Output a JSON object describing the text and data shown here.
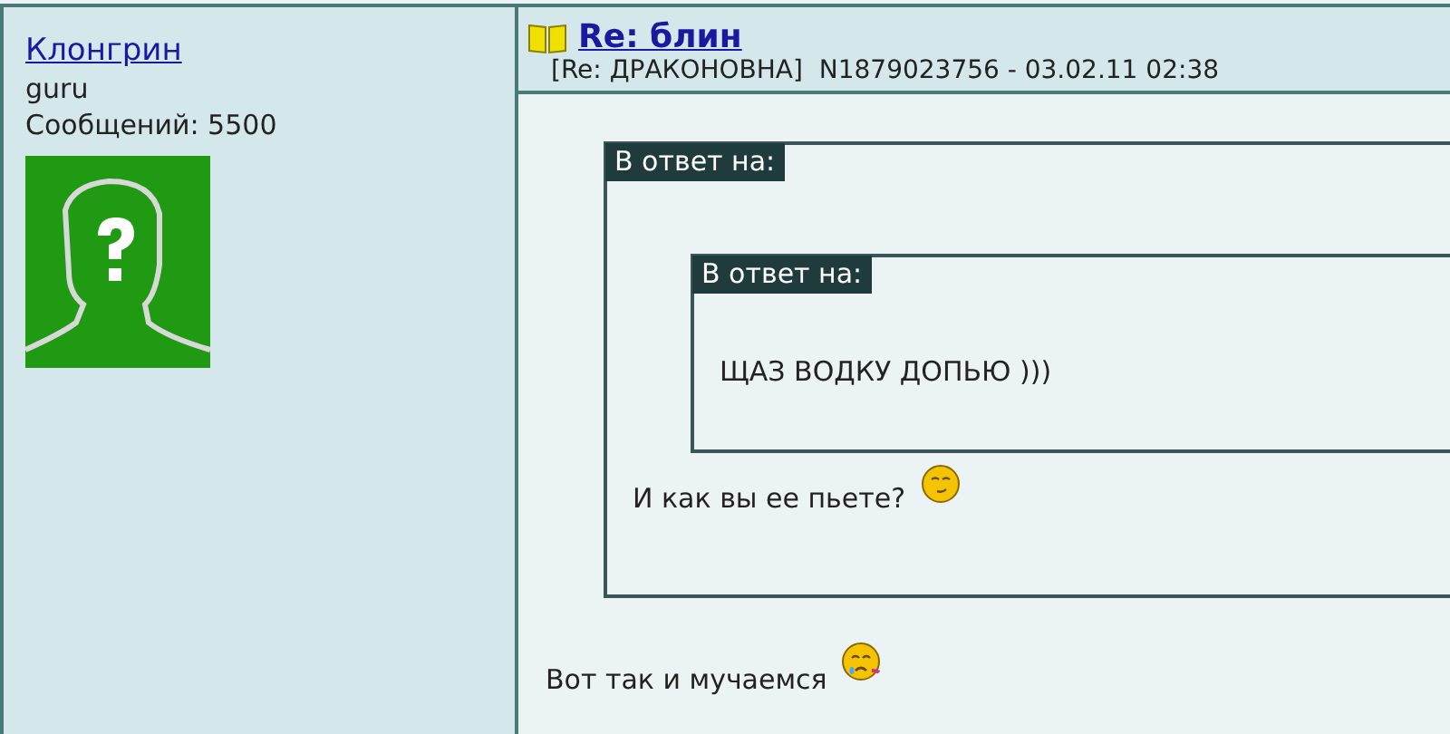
{
  "author": {
    "name": "Клонгрин",
    "rank": "guru",
    "posts": "Сообщений: 5500"
  },
  "post": {
    "title": "Re: блин",
    "meta": "[Re: ДРАКОНОВНА]  N1879023756 - 03.02.11 02:38",
    "quote": {
      "label": "В ответ на:",
      "text": "И как вы ее пьете?",
      "smiley": {
        "kind": "content"
      },
      "quote": {
        "label": "В ответ на:",
        "text": "ЩАЗ ВОДКУ ДОПЬЮ )))"
      }
    },
    "text": "Вот так и мучаемся",
    "smiley": {
      "kind": "sad"
    }
  }
}
